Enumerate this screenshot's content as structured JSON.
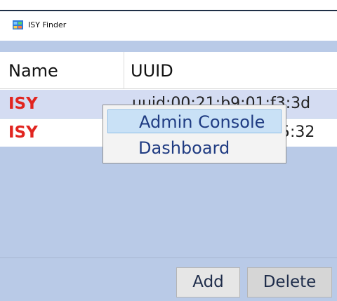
{
  "window": {
    "title": "ISY Finder",
    "app_icon": "isy-finder-app-icon"
  },
  "table": {
    "columns": [
      "Name",
      "UUID"
    ],
    "rows": [
      {
        "name": "ISY",
        "uuid": "uuid:00:21:b9:01:f3:3d"
      },
      {
        "name": "ISY",
        "uuid": "uuid:00:21:b9:02:35:32"
      }
    ]
  },
  "context_menu": {
    "items": [
      "Admin Console",
      "Dashboard"
    ],
    "highlighted": "Admin Console"
  },
  "buttons": {
    "add": "Add",
    "delete": "Delete"
  },
  "colors": {
    "background_band": "#b9cae7",
    "selected_row": "#d4dcf2",
    "device_name": "#e12520",
    "menu_text": "#1f3b82",
    "menu_highlight": "#c9e1f6",
    "button_text": "#1f2d4b"
  }
}
